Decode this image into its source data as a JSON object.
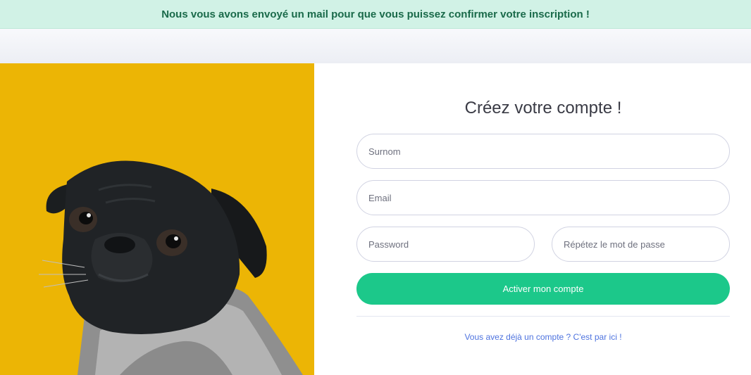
{
  "alert": {
    "message": "Nous vous avons envoyé un mail pour que vous puissez confirmer votre inscription !"
  },
  "form": {
    "title": "Créez votre compte !",
    "surnom_placeholder": "Surnom",
    "email_placeholder": "Email",
    "password_placeholder": "Password",
    "password_repeat_placeholder": "Répétez le mot de passe",
    "submit_label": "Activer mon compte",
    "login_link": "Vous avez déjà un compte ? C'est par ici !"
  },
  "colors": {
    "alert_bg": "#d1f2e6",
    "alert_text": "#1a6a4a",
    "photo_bg": "#ecb505",
    "primary_button": "#1cc88a",
    "link": "#4e73df"
  }
}
